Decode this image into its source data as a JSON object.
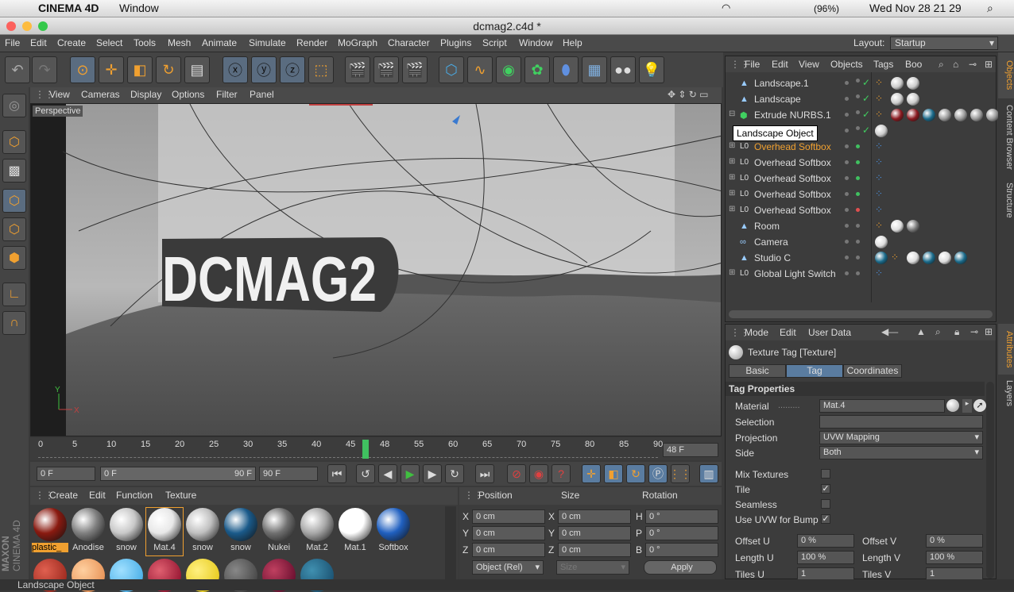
{
  "mac": {
    "app": "CINEMA 4D",
    "menu": "Window",
    "battery": "(96%)",
    "datetime": "Wed Nov 28  21 29"
  },
  "window_title": "dcmag2.c4d *",
  "menus": [
    "File",
    "Edit",
    "Create",
    "Select",
    "Tools",
    "Mesh",
    "Animate",
    "Simulate",
    "Render",
    "MoGraph",
    "Character",
    "Plugins",
    "Script",
    "Window",
    "Help"
  ],
  "layout": {
    "label": "Layout:",
    "value": "Startup"
  },
  "viewport": {
    "menu": [
      "View",
      "Cameras",
      "Display",
      "Options",
      "Filter",
      "Panel"
    ],
    "label": "Perspective",
    "text3d": "DCMAG2",
    "axis_y": "Y",
    "axis_x": "X"
  },
  "timeline": {
    "ticks": [
      "0",
      "5",
      "10",
      "15",
      "20",
      "25",
      "30",
      "35",
      "40",
      "45",
      "48",
      "55",
      "60",
      "65",
      "70",
      "75",
      "80",
      "85",
      "90"
    ],
    "current": "48 F"
  },
  "transport": {
    "start": "0 F",
    "range_start": "0 F",
    "range_end": "90 F",
    "end": "90 F"
  },
  "material_manager": {
    "menu": [
      "Create",
      "Edit",
      "Function",
      "Texture"
    ],
    "materials": [
      {
        "name": "plastic_",
        "color": "#8a1a10"
      },
      {
        "name": "Anodise",
        "color": "#808080"
      },
      {
        "name": "snow",
        "color": "#c8c8c8"
      },
      {
        "name": "Mat.4",
        "color": "#e8e8e8"
      },
      {
        "name": "snow",
        "color": "#c0c0c0"
      },
      {
        "name": "snow",
        "color": "#1a5a8a"
      },
      {
        "name": "Nukei",
        "color": "#707070"
      },
      {
        "name": "Mat.2",
        "color": "#a8a8a8"
      },
      {
        "name": "Mat.1",
        "color": "#ffffff"
      },
      {
        "name": "Softbox",
        "color": "#2060c0"
      }
    ]
  },
  "coords": {
    "headers": [
      "Position",
      "Size",
      "Rotation"
    ],
    "rows": [
      {
        "axis": "X",
        "pos": "0 cm",
        "saxis": "X",
        "size": "0 cm",
        "raxis": "H",
        "rot": "0 °"
      },
      {
        "axis": "Y",
        "pos": "0 cm",
        "saxis": "Y",
        "size": "0 cm",
        "raxis": "P",
        "rot": "0 °"
      },
      {
        "axis": "Z",
        "pos": "0 cm",
        "saxis": "Z",
        "size": "0 cm",
        "raxis": "B",
        "rot": "0 °"
      }
    ],
    "mode": "Object (Rel)",
    "size_mode": "Size",
    "apply": "Apply"
  },
  "object_manager": {
    "menu": [
      "File",
      "Edit",
      "View",
      "Objects",
      "Tags",
      "Boo"
    ],
    "objects": [
      "Landscape.1",
      "Landscape",
      "Extrude NURBS.1",
      "",
      "Overhead Softbox",
      "Overhead Softbox",
      "Overhead Softbox",
      "Overhead Softbox",
      "Overhead Softbox",
      "Room",
      "Camera",
      "Studio C",
      "Global Light Switch"
    ],
    "tooltip": "Landscape Object"
  },
  "attributes": {
    "menu": [
      "Mode",
      "Edit",
      "User Data"
    ],
    "title": "Texture Tag [Texture]",
    "tabs": [
      "Basic",
      "Tag",
      "Coordinates"
    ],
    "section": "Tag Properties",
    "material_label": "Material",
    "material_value": "Mat.4",
    "selection_label": "Selection",
    "projection_label": "Projection",
    "projection_value": "UVW Mapping",
    "side_label": "Side",
    "side_value": "Both",
    "mix_textures": "Mix Textures",
    "tile": "Tile",
    "seamless": "Seamless",
    "uvw_bump": "Use UVW for Bump",
    "offset_u": "Offset U",
    "offset_u_val": "0 %",
    "offset_v": "Offset V",
    "offset_v_val": "0 %",
    "length_u": "Length U",
    "length_u_val": "100 %",
    "length_v": "Length V",
    "length_v_val": "100 %",
    "tiles_u": "Tiles U",
    "tiles_u_val": "1",
    "tiles_v": "Tiles V",
    "tiles_v_val": "1"
  },
  "side_tabs": [
    "Objects",
    "Content Browser",
    "Structure",
    "Attributes",
    "Layers"
  ],
  "maxon": {
    "line1": "MAXON",
    "line2": "CINEMA 4D"
  },
  "status": "Landscape Object",
  "colors": {
    "accent": "#f0a030",
    "highlight": "#5a7ca0",
    "panel": "#3c3c3c"
  }
}
